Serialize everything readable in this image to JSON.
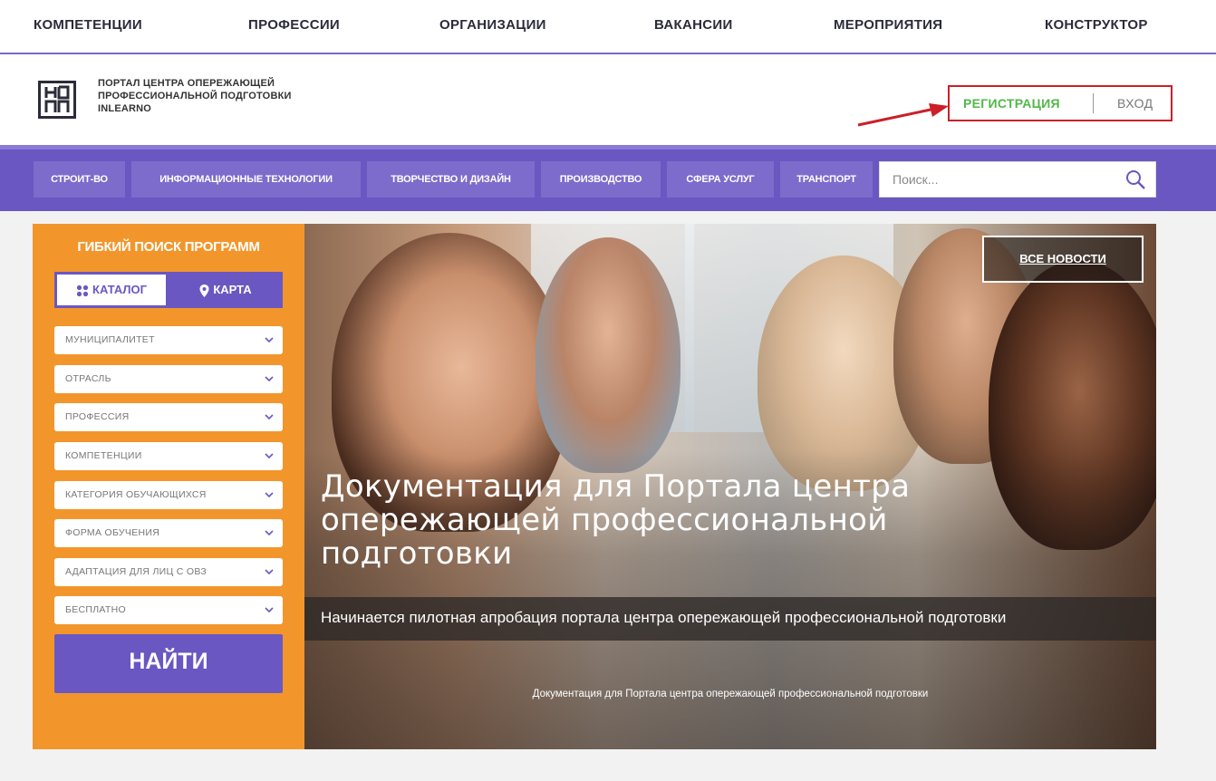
{
  "top_nav": {
    "items": [
      "КОМПЕТЕНЦИИ",
      "ПРОФЕССИИ",
      "ОРГАНИЗАЦИИ",
      "ВАКАНСИИ",
      "МЕРОПРИЯТИЯ",
      "КОНСТРУКТОР"
    ]
  },
  "header": {
    "logo_lines": [
      "ПОРТАЛ ЦЕНТРА ОПЕРЕЖАЮЩЕЙ",
      "ПРОФЕССИОНАЛЬНОЙ ПОДГОТОВКИ",
      "INLEARNO"
    ],
    "register_label": "РЕГИСТРАЦИЯ",
    "login_label": "ВХОД",
    "annotation_color": "#cc1f28"
  },
  "categories": {
    "items": [
      "СТРОИТ-ВО",
      "ИНФОРМАЦИОННЫЕ ТЕХНОЛОГИИ",
      "ТВОРЧЕСТВО И ДИЗАЙН",
      "ПРОИЗВОДСТВО",
      "СФЕРА УСЛУГ",
      "ТРАНСПОРТ"
    ],
    "search_placeholder": "Поиск..."
  },
  "filter_panel": {
    "title": "ГИБКИЙ ПОИСК ПРОГРАММ",
    "tab_catalog": "КАТАЛОГ",
    "tab_map": "КАРТА",
    "selects": [
      "МУНИЦИПАЛИТЕТ",
      "ОТРАСЛЬ",
      "ПРОФЕССИЯ",
      "КОМПЕТЕНЦИИ",
      "КАТЕГОРИЯ ОБУЧАЮЩИХСЯ",
      "ФОРМА ОБУЧЕНИЯ",
      "АДАПТАЦИЯ ДЛЯ ЛИЦ С ОВЗ",
      "БЕСПЛАТНО"
    ],
    "find_label": "НАЙТИ"
  },
  "hero": {
    "all_news_label": "ВСЕ НОВОСТИ",
    "title": "Документация для Портала центра опережающей профессиональной подготовки",
    "subtitle": "Начинается пилотная апробация портала центра опережающей профессиональной подготовки",
    "footer": "Документация для Портала центра опережающей профессиональной подготовки"
  },
  "colors": {
    "brand_purple": "#6b57c1",
    "panel_orange": "#f2962c",
    "register_green": "#52b848"
  }
}
